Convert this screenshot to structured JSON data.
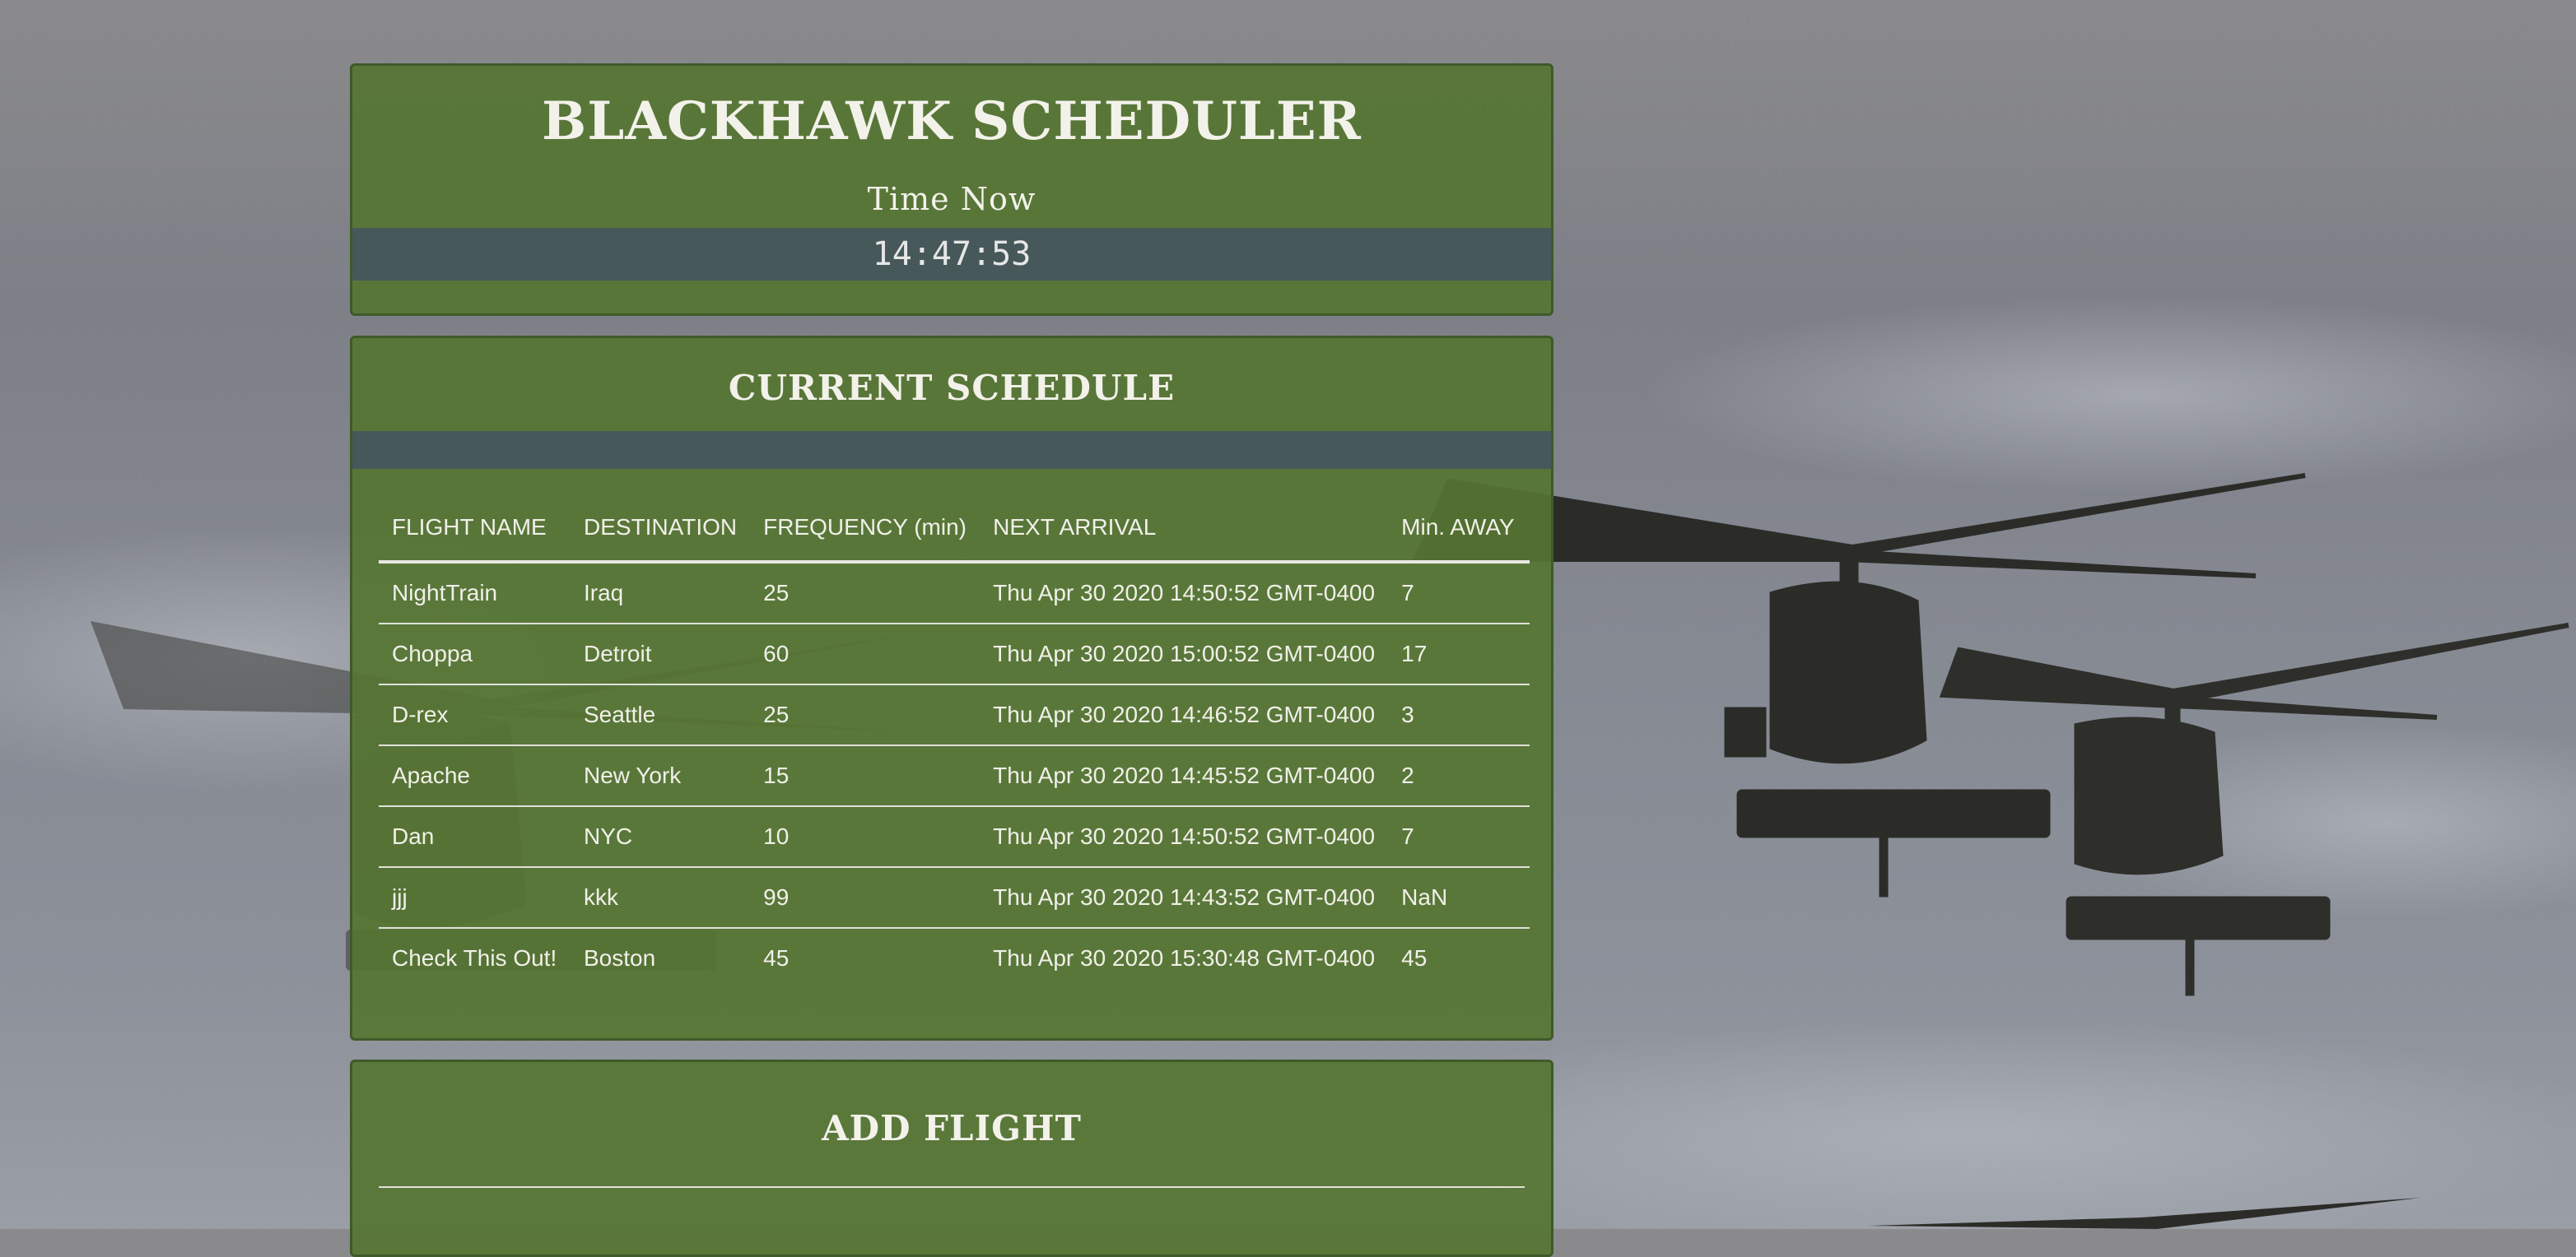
{
  "header": {
    "title": "BLACKHAWK SCHEDULER",
    "time_label": "Time Now",
    "time_value": "14:47:53"
  },
  "schedule": {
    "title": "CURRENT SCHEDULE",
    "columns": [
      "FLIGHT NAME",
      "DESTINATION",
      "FREQUENCY (min)",
      "NEXT ARRIVAL",
      "Min. AWAY"
    ],
    "rows": [
      [
        "NightTrain",
        "Iraq",
        "25",
        "Thu Apr 30 2020 14:50:52 GMT-0400",
        "7"
      ],
      [
        "Choppa",
        "Detroit",
        "60",
        "Thu Apr 30 2020 15:00:52 GMT-0400",
        "17"
      ],
      [
        "D-rex",
        "Seattle",
        "25",
        "Thu Apr 30 2020 14:46:52 GMT-0400",
        "3"
      ],
      [
        "Apache",
        "New York",
        "15",
        "Thu Apr 30 2020 14:45:52 GMT-0400",
        "2"
      ],
      [
        "Dan",
        "NYC",
        "10",
        "Thu Apr 30 2020 14:50:52 GMT-0400",
        "7"
      ],
      [
        "jjj",
        "kkk",
        "99",
        "Thu Apr 30 2020 14:43:52 GMT-0400",
        "NaN"
      ],
      [
        "Check This Out!",
        "Boston",
        "45",
        "Thu Apr 30 2020 15:30:48 GMT-0400",
        "45"
      ]
    ]
  },
  "add_flight": {
    "title": "ADD FLIGHT"
  }
}
